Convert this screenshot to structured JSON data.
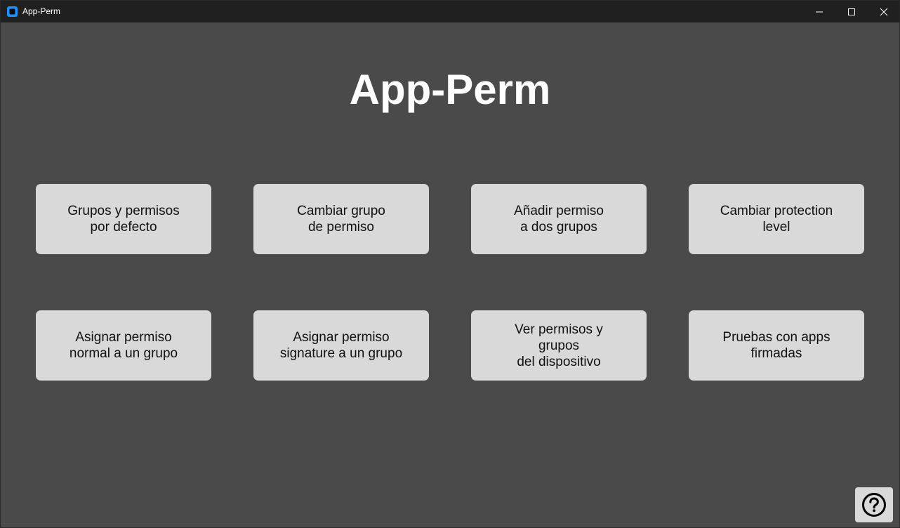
{
  "window": {
    "title": "App-Perm"
  },
  "main": {
    "heading": "App-Perm",
    "buttons": [
      {
        "label": "Grupos y permisos\npor defecto"
      },
      {
        "label": "Cambiar grupo\nde permiso"
      },
      {
        "label": "Añadir permiso\na dos grupos"
      },
      {
        "label": "Cambiar protection\nlevel"
      },
      {
        "label": "Asignar permiso\nnormal a un grupo"
      },
      {
        "label": "Asignar permiso\nsignature a un grupo"
      },
      {
        "label": "Ver permisos y\ngrupos\ndel dispositivo"
      },
      {
        "label": "Pruebas con apps\nfirmadas"
      }
    ],
    "help_icon": "question-circle-icon"
  },
  "colors": {
    "background": "#4a4a4a",
    "titlebar": "#202020",
    "tile": "#d9d9d9",
    "app_icon": "#1e90ff"
  }
}
